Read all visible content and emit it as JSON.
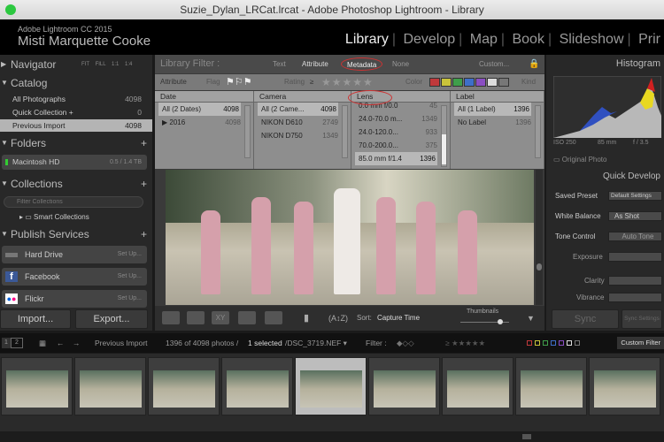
{
  "window": {
    "title": "Suzie_Dylan_LRCat.lrcat - Adobe Photoshop Lightroom - Library"
  },
  "header": {
    "product": "Adobe Lightroom CC 2015",
    "identity": "Misti Marquette Cooke",
    "modules": [
      "Library",
      "Develop",
      "Map",
      "Book",
      "Slideshow",
      "Prir"
    ]
  },
  "left": {
    "navigator": {
      "title": "Navigator",
      "zooms": [
        "FIT",
        "FILL",
        "1:1",
        "1:4"
      ]
    },
    "catalog": {
      "title": "Catalog",
      "items": [
        {
          "label": "All Photographs",
          "count": "4098"
        },
        {
          "label": "Quick Collection +",
          "count": "0"
        },
        {
          "label": "Previous Import",
          "count": "4098"
        }
      ]
    },
    "folders": {
      "title": "Folders",
      "drive": "Macintosh HD",
      "size": "0.5 / 1.4 TB"
    },
    "collections": {
      "title": "Collections",
      "filter_placeholder": "Filter Collections",
      "smart": "Smart Collections"
    },
    "publish": {
      "title": "Publish Services",
      "items": [
        {
          "label": "Hard Drive",
          "action": "Set Up..."
        },
        {
          "label": "Facebook",
          "action": "Set Up..."
        },
        {
          "label": "Flickr",
          "action": "Set Up..."
        }
      ]
    },
    "import": "Import...",
    "export": "Export..."
  },
  "filter": {
    "title": "Library Filter :",
    "tabs": [
      "Text",
      "Attribute",
      "Metadata",
      "None"
    ],
    "preset": "Custom...",
    "attr": {
      "label": "Attribute",
      "flag": "Flag",
      "rating": "Rating",
      "ge": "≥",
      "color": "Color",
      "kind": "Kind"
    },
    "colors": [
      "#c0393b",
      "#c9c33a",
      "#3f9e4a",
      "#3e6fc9",
      "#8a4ec2",
      "#dddddd",
      "#777777"
    ],
    "columns": [
      {
        "title": "Date",
        "items": [
          {
            "label": "All (2 Dates)",
            "count": "4098"
          },
          {
            "label": "▶ 2016",
            "count": "4098"
          }
        ]
      },
      {
        "title": "Camera",
        "items": [
          {
            "label": "All (2 Came...",
            "count": "4098"
          },
          {
            "label": "NIKON D610",
            "count": "2749"
          },
          {
            "label": "NIKON D750",
            "count": "1349"
          }
        ]
      },
      {
        "title": "Lens",
        "items": [
          {
            "label": "0.0 mm f/0.0",
            "count": "45"
          },
          {
            "label": "24.0-70.0 m...",
            "count": "1349"
          },
          {
            "label": "24.0-120.0...",
            "count": "933"
          },
          {
            "label": "70.0-200.0...",
            "count": "375"
          },
          {
            "label": "85.0 mm f/1.4",
            "count": "1396"
          }
        ]
      },
      {
        "title": "Label",
        "items": [
          {
            "label": "All (1 Label)",
            "count": "1396"
          },
          {
            "label": "No Label",
            "count": "1396"
          }
        ]
      }
    ]
  },
  "toolbar": {
    "sort_label": "Sort:",
    "sort_value": "Capture Time",
    "thumbnails": "Thumbnails",
    "thumb_size": 0.8
  },
  "right": {
    "histogram_title": "Histogram",
    "iso": "ISO 250",
    "focal": "85 mm",
    "aperture": "f / 3.5",
    "original": "Original Photo",
    "quick_develop": "Quick Develop",
    "saved_preset_label": "Saved Preset",
    "saved_preset": "Default Settings",
    "wb_label": "White Balance",
    "wb": "As Shot",
    "tone_label": "Tone Control",
    "auto_tone": "Auto Tone",
    "exposure": "Exposure",
    "clarity": "Clarity",
    "vibrance": "Vibrance",
    "sync": "Sync",
    "sync_settings": "Sync Settings"
  },
  "filmstrip": {
    "page1": "1",
    "page2": "2",
    "source": "Previous Import",
    "count_text": "1396 of 4098 photos /",
    "selected": "1 selected",
    "file": "/DSC_3719.NEF",
    "filter_label": "Filter :",
    "custom_filter": "Custom Filter"
  }
}
